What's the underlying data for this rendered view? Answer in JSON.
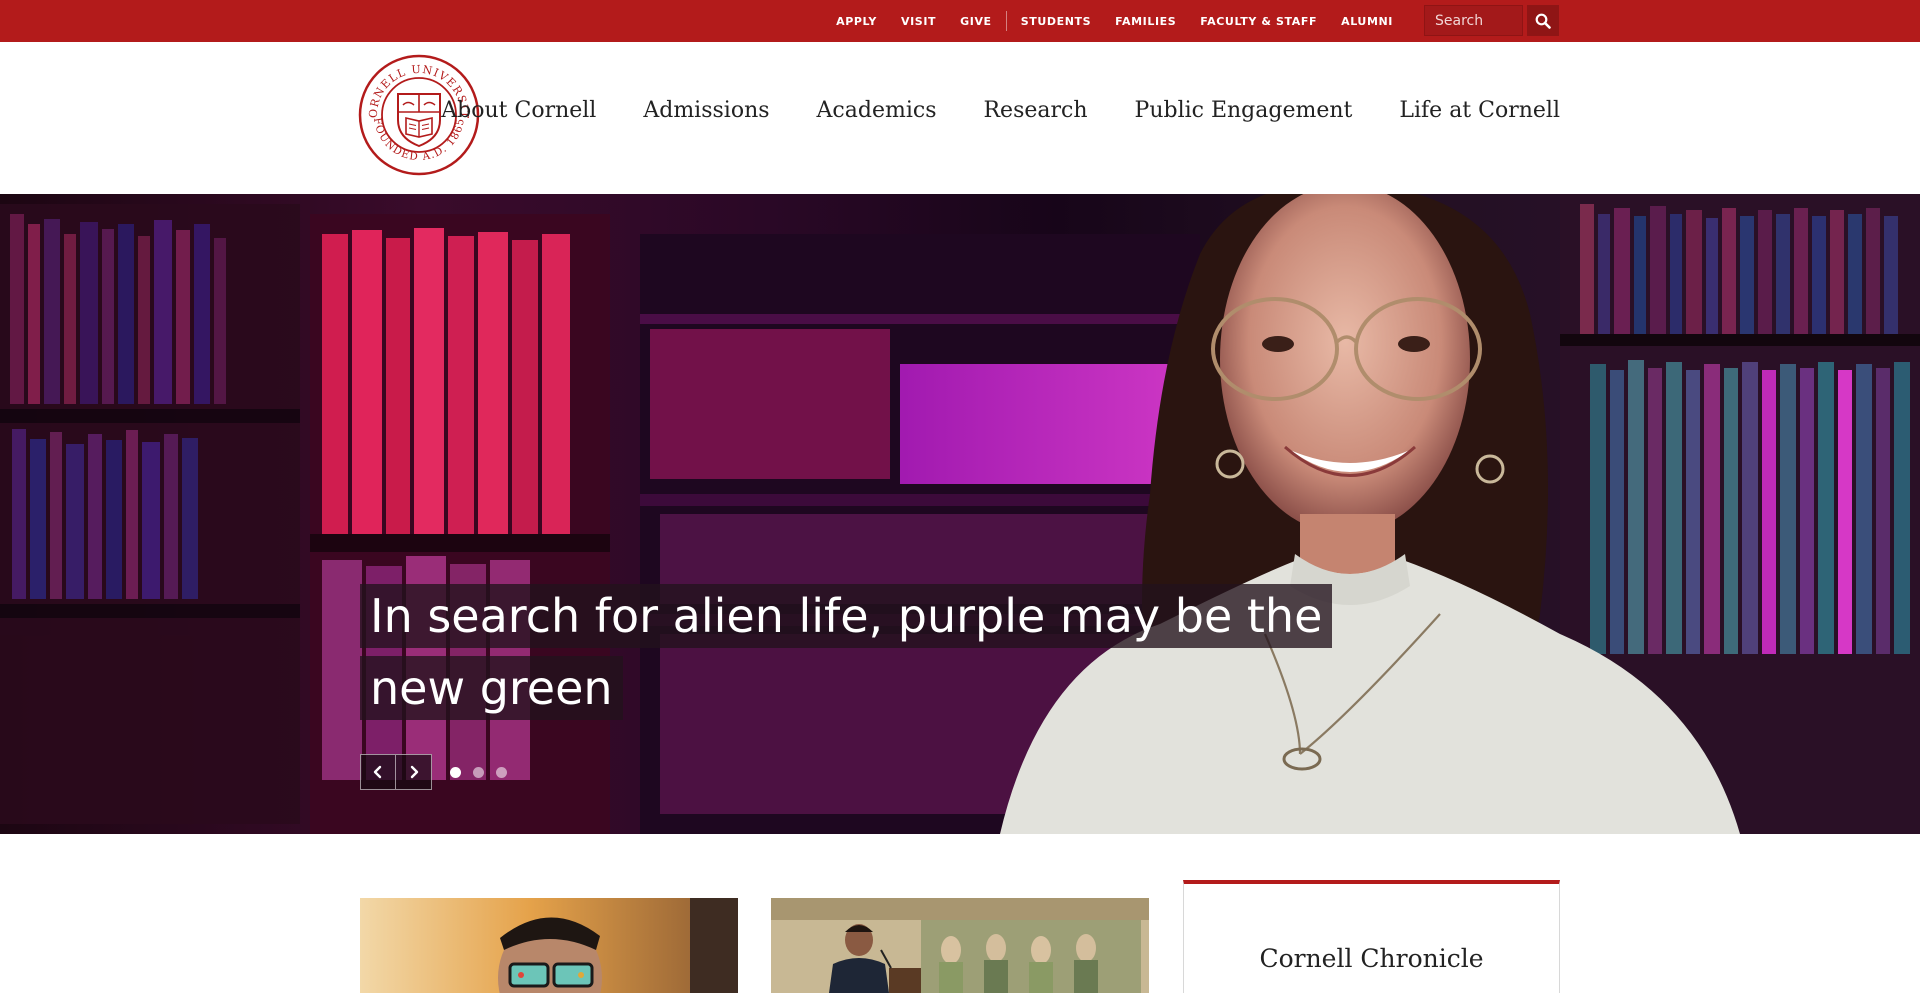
{
  "utility_nav": {
    "links": [
      "APPLY",
      "VISIT",
      "GIVE",
      "STUDENTS",
      "FAMILIES",
      "FACULTY & STAFF",
      "ALUMNI"
    ],
    "search_placeholder": "Search",
    "search_icon": "search-icon"
  },
  "header": {
    "seal": {
      "top_text": "CORNELL UNIVERSITY",
      "bottom_text": "FOUNDED A.D. 1865"
    },
    "nav": [
      "About Cornell",
      "Admissions",
      "Academics",
      "Research",
      "Public Engagement",
      "Life at Cornell"
    ]
  },
  "hero": {
    "caption_lines": [
      "In search for alien life, purple may be the",
      "new green"
    ],
    "prev_icon": "chevron-left-icon",
    "next_icon": "chevron-right-icon",
    "slide_count": 3,
    "active_slide": 1
  },
  "chronicle": {
    "title": "Cornell Chronicle"
  },
  "colors": {
    "brand_red": "#b31b1b",
    "text_dark": "#222222"
  }
}
